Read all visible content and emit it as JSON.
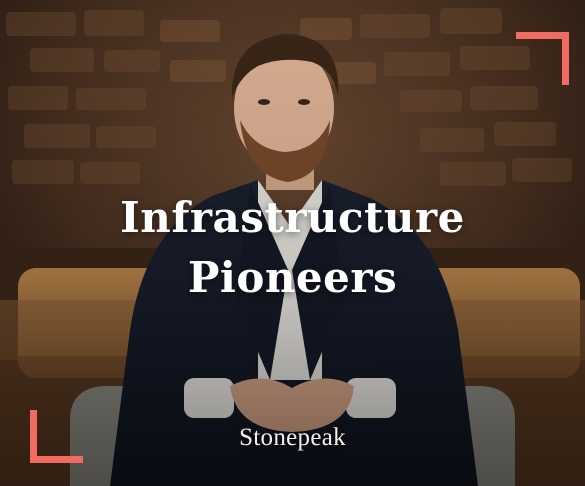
{
  "ad": {
    "headline_line1": "Infrastructure",
    "headline_line2": "Pioneers",
    "brand": "Stonepeak",
    "accent_color": "#f26b62"
  }
}
